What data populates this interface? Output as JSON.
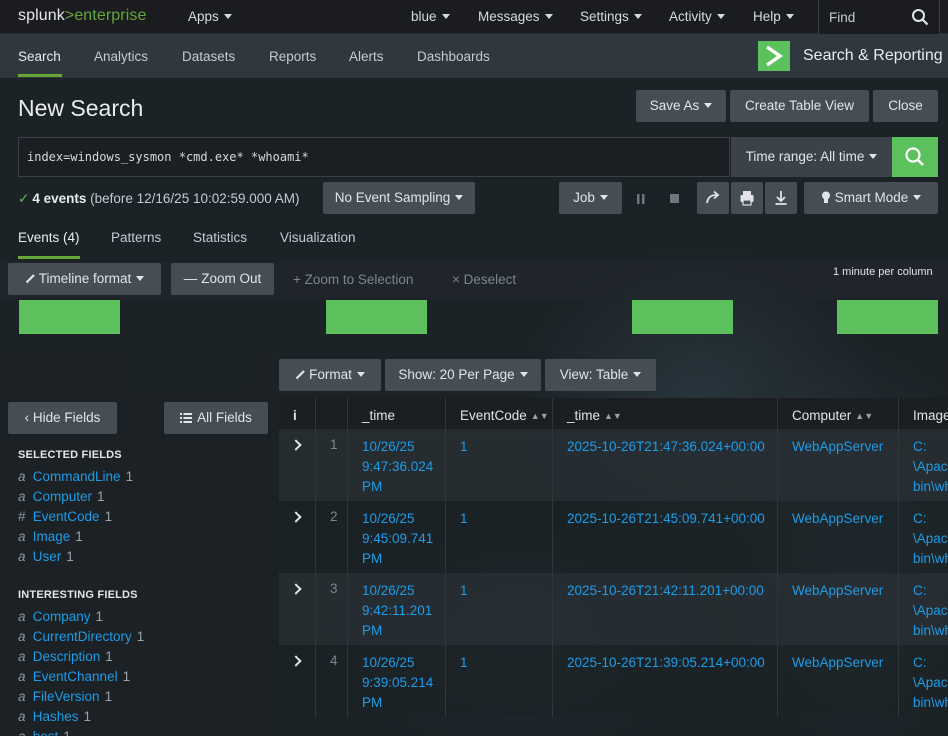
{
  "topbar": {
    "logo_prefix": "splunk",
    "logo_gt": ">",
    "logo_suffix": "enterprise",
    "apps_label": "Apps",
    "user_label": "blue",
    "messages_label": "Messages",
    "settings_label": "Settings",
    "activity_label": "Activity",
    "help_label": "Help",
    "find_placeholder": "Find"
  },
  "appbar": {
    "tabs": [
      "Search",
      "Analytics",
      "Datasets",
      "Reports",
      "Alerts",
      "Dashboards"
    ],
    "active_tab": "Search",
    "app_title": "Search & Reporting",
    "app_logo_glyph": ">"
  },
  "page": {
    "title": "New Search",
    "save_as_label": "Save As",
    "create_table_view_label": "Create Table View",
    "close_label": "Close"
  },
  "search": {
    "query": "index=windows_sysmon *cmd.exe* *whoami*",
    "time_range_label": "Time range: All time"
  },
  "status": {
    "events_count": "4 events",
    "events_detail": "(before 12/16/25 10:02:59.000 AM)",
    "sampling_label": "No Event Sampling",
    "job_label": "Job",
    "smart_mode_label": "Smart Mode"
  },
  "result_tabs": [
    "Events (4)",
    "Patterns",
    "Statistics",
    "Visualization"
  ],
  "timeline": {
    "format_label": "Timeline format",
    "zoom_out_label": "Zoom Out",
    "zoom_selection_label": "Zoom to Selection",
    "deselect_label": "Deselect",
    "scale_label": "1 minute per column",
    "bar_color": "#5cc05c"
  },
  "table_controls": {
    "format_label": "Format",
    "show_label": "Show: 20 Per Page",
    "view_label": "View: Table"
  },
  "sidebar": {
    "hide_fields_label": "Hide Fields",
    "all_fields_label": "All Fields",
    "selected_header": "SELECTED FIELDS",
    "selected": [
      {
        "type": "a",
        "name": "CommandLine",
        "count": "1"
      },
      {
        "type": "a",
        "name": "Computer",
        "count": "1"
      },
      {
        "type": "#",
        "name": "EventCode",
        "count": "1"
      },
      {
        "type": "a",
        "name": "Image",
        "count": "1"
      },
      {
        "type": "a",
        "name": "User",
        "count": "1"
      }
    ],
    "interesting_header": "INTERESTING FIELDS",
    "interesting": [
      {
        "type": "a",
        "name": "Company",
        "count": "1"
      },
      {
        "type": "a",
        "name": "CurrentDirectory",
        "count": "1"
      },
      {
        "type": "a",
        "name": "Description",
        "count": "1"
      },
      {
        "type": "a",
        "name": "EventChannel",
        "count": "1"
      },
      {
        "type": "a",
        "name": "FileVersion",
        "count": "1"
      },
      {
        "type": "a",
        "name": "Hashes",
        "count": "1"
      },
      {
        "type": "a",
        "name": "host",
        "count": "1"
      }
    ]
  },
  "table": {
    "columns": [
      "i",
      "_time",
      "EventCode",
      "_time",
      "Computer",
      "Image"
    ],
    "rows": [
      {
        "num": "1",
        "time": "10/26/25\n9:47:36.024\nPM",
        "event_code": "1",
        "time_iso": "2025-10-26T21:47:36.024+00:00",
        "computer": "WebAppServer",
        "image": "C:\n\\Apache\nbin\\wh"
      },
      {
        "num": "2",
        "time": "10/26/25\n9:45:09.741\nPM",
        "event_code": "1",
        "time_iso": "2025-10-26T21:45:09.741+00:00",
        "computer": "WebAppServer",
        "image": "C:\n\\Apache\nbin\\wh"
      },
      {
        "num": "3",
        "time": "10/26/25\n9:42:11.201\nPM",
        "event_code": "1",
        "time_iso": "2025-10-26T21:42:11.201+00:00",
        "computer": "WebAppServer",
        "image": "C:\n\\Apache\nbin\\wh"
      },
      {
        "num": "4",
        "time": "10/26/25\n9:39:05.214\nPM",
        "event_code": "1",
        "time_iso": "2025-10-26T21:39:05.214+00:00",
        "computer": "WebAppServer",
        "image": "C:\n\\Apache\nbin\\wh"
      }
    ]
  },
  "colors": {
    "accent_green": "#5cc05c",
    "link_blue": "#1e9ce8"
  }
}
